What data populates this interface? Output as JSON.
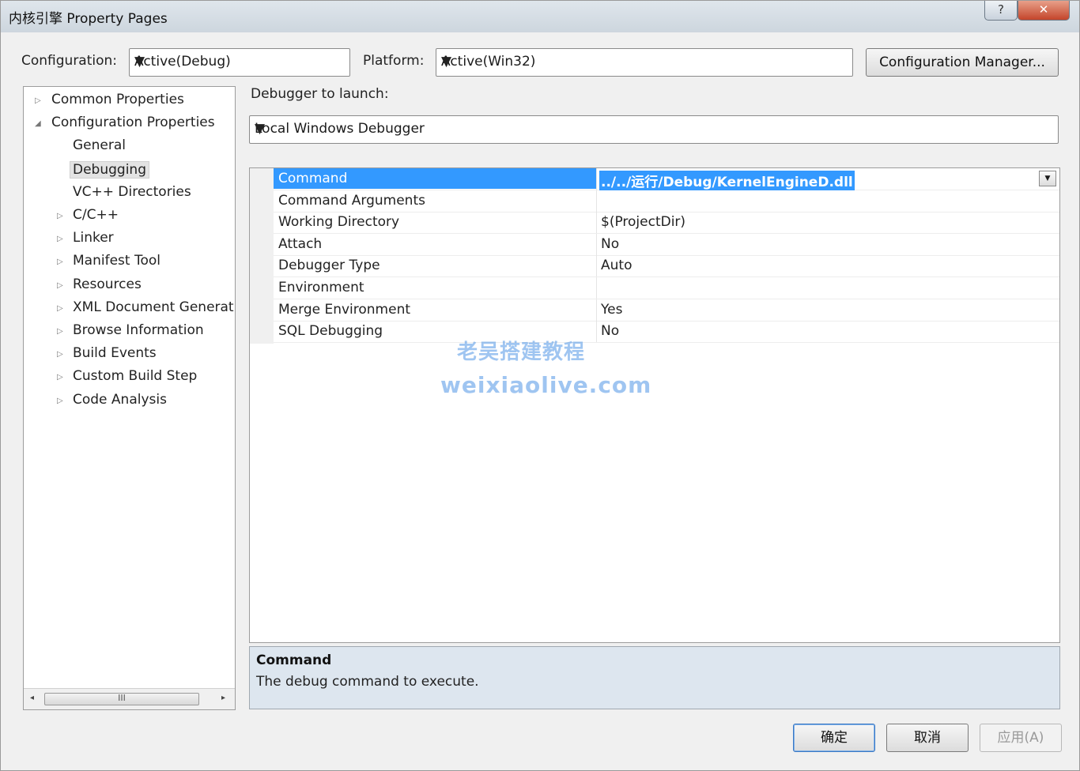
{
  "window": {
    "title": "内核引擎 Property Pages",
    "help_glyph": "?",
    "close_glyph": "✕"
  },
  "toolbar": {
    "configuration_label": "Configuration:",
    "configuration_value": "Active(Debug)",
    "platform_label": "Platform:",
    "platform_value": "Active(Win32)",
    "config_manager_button": "Configuration Manager..."
  },
  "tree": {
    "items": [
      {
        "label": "Common Properties",
        "expander": "▷"
      },
      {
        "label": "Configuration Properties",
        "expander": "◢"
      },
      {
        "label": "General",
        "expander": ""
      },
      {
        "label": "Debugging",
        "expander": ""
      },
      {
        "label": "VC++ Directories",
        "expander": ""
      },
      {
        "label": "C/C++",
        "expander": "▷"
      },
      {
        "label": "Linker",
        "expander": "▷"
      },
      {
        "label": "Manifest Tool",
        "expander": "▷"
      },
      {
        "label": "Resources",
        "expander": "▷"
      },
      {
        "label": "XML Document Generat",
        "expander": "▷"
      },
      {
        "label": "Browse Information",
        "expander": "▷"
      },
      {
        "label": "Build Events",
        "expander": "▷"
      },
      {
        "label": "Custom Build Step",
        "expander": "▷"
      },
      {
        "label": "Code Analysis",
        "expander": "▷"
      }
    ],
    "scroll_thumb": "III",
    "scroll_left": "◂",
    "scroll_right": "▸"
  },
  "debugger": {
    "label": "Debugger to launch:",
    "value": "Local Windows Debugger"
  },
  "properties": [
    {
      "name": "Command",
      "value": "../../运行/Debug/KernelEngineD.dll"
    },
    {
      "name": "Command Arguments",
      "value": ""
    },
    {
      "name": "Working Directory",
      "value": "$(ProjectDir)"
    },
    {
      "name": "Attach",
      "value": "No"
    },
    {
      "name": "Debugger Type",
      "value": "Auto"
    },
    {
      "name": "Environment",
      "value": ""
    },
    {
      "name": "Merge Environment",
      "value": "Yes"
    },
    {
      "name": "SQL Debugging",
      "value": "No"
    }
  ],
  "description": {
    "title": "Command",
    "text": "The debug command to execute."
  },
  "watermark": {
    "line1": "老吴搭建教程",
    "line2": "weixiaolive.com"
  },
  "footer": {
    "ok": "确定",
    "cancel": "取消",
    "apply": "应用(A)"
  }
}
